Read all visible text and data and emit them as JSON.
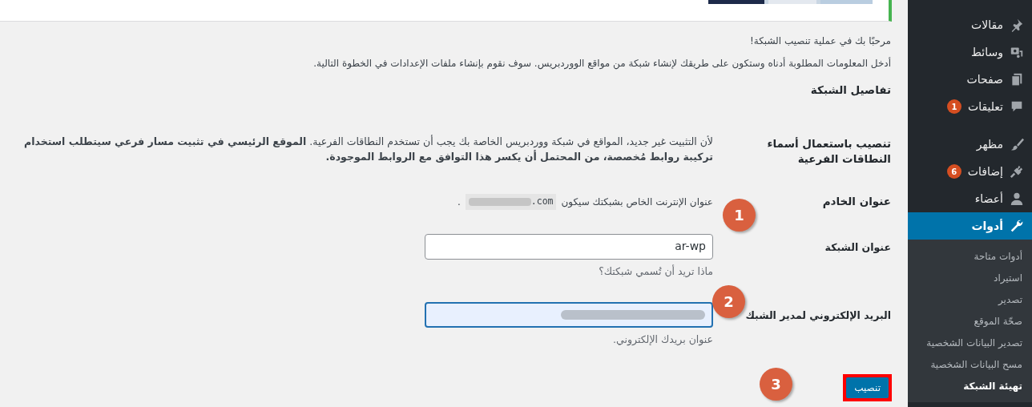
{
  "intro": [
    "مرحبًا بك في عملية تنصيب الشبكة!",
    "أدخل المعلومات المطلوبة أدناه وستكون على طريقك لإنشاء شبكة من مواقع الووردبريس. سوف نقوم بإنشاء ملفات الإعدادات في الخطوة التالية."
  ],
  "section_title": "تفاصيل الشبكة",
  "fields": [
    {
      "kind": "description",
      "label": "تنصيب باستعمال أسماء النطاقات الفرعية",
      "text": "لأن التثبيت غير جديد، المواقع في شبكة ووردبريس الخاصة بك يجب أن تستخدم النطاقات الفرعية. **الموقع الرئيسي في تثبيت مسار فرعي سيتطلب استخدام تركيبة روابط مُخصصة، من المحتمل أن يكسر هذا التوافق مع الروابط الموجودة.**"
    },
    {
      "kind": "server",
      "label": "عنوان الخادم",
      "text": "عنوان الإنترنت الخاص بشبكتك سيكون",
      "code": ".com",
      "end": "."
    },
    {
      "kind": "input",
      "label": "عنوان الشبكة",
      "value": "ar-wp",
      "hint": "ماذا تريد أن تُسمي شبكتك؟",
      "focused": false
    },
    {
      "kind": "input",
      "label": "البريد الإلكتروني لمدير الشبك",
      "hint": "عنوان بريدك الإلكتروني.",
      "focused": true,
      "redacted": true
    }
  ],
  "submit": {
    "label": "تنصيب",
    "highlighted": true
  },
  "step_markers": [
    "1",
    "2",
    "3"
  ],
  "sidebar": {
    "items": [
      {
        "label": "مقالات",
        "selected": false
      },
      {
        "label": "وسائط",
        "selected": false
      },
      {
        "label": "صفحات",
        "selected": false
      },
      {
        "label": "تعليقات",
        "badge": "1",
        "selected": false
      },
      {
        "label": "مظهر",
        "selected": false
      },
      {
        "label": "إضافات",
        "badge": "6",
        "selected": false
      },
      {
        "label": "أعضاء",
        "selected": false
      },
      {
        "label": "أدوات",
        "selected": true
      }
    ],
    "submenu": [
      {
        "label": "أدوات متاحة",
        "selected": false
      },
      {
        "label": "استيراد",
        "selected": false
      },
      {
        "label": "تصدير",
        "selected": false
      },
      {
        "label": "صحّة الموقع",
        "selected": false
      },
      {
        "label": "تصدير البيانات الشخصية",
        "selected": false
      },
      {
        "label": "مسح البيانات الشخصية",
        "selected": false
      },
      {
        "label": "تهيئة الشبكة",
        "selected": true
      }
    ]
  }
}
